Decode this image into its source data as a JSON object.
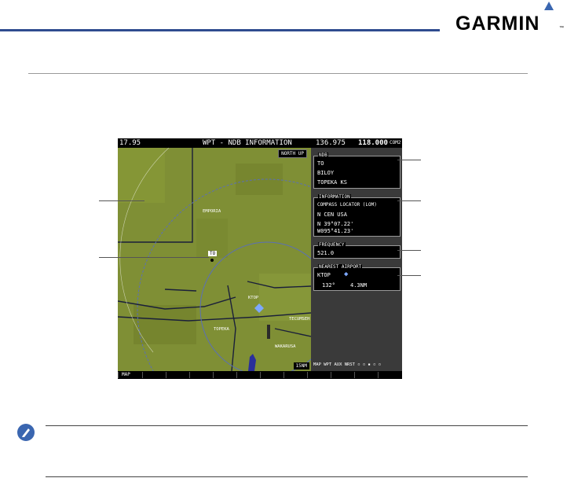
{
  "brand": {
    "name": "GARMIN",
    "tm": "™"
  },
  "screen": {
    "topbar": {
      "nav_freq": "17.95",
      "page_title": "WPT - NDB INFORMATION",
      "com_standby": "136.975",
      "com_active": "118.000",
      "com_label": "COM2"
    },
    "map": {
      "orientation": "NORTH UP",
      "range": "15NM",
      "waypoint_label": "TO",
      "place_labels": [
        "EMPORIA",
        "KTOP",
        "TOPEKA",
        "TECUMSEH",
        "WAKARUSA"
      ]
    },
    "ndb": {
      "title": "NDB",
      "ident": "TO",
      "name": "BILOY",
      "city": "TOPEKA KS"
    },
    "information": {
      "title": "INFORMATION",
      "type": "COMPASS LOCATOR (LOM)",
      "region": "N CEN USA",
      "lat": "N 39°07.22'",
      "lon": "W095°41.23'"
    },
    "frequency": {
      "title": "FREQUENCY",
      "value": "521.0"
    },
    "nearest_airport": {
      "title": "NEAREST AIRPORT",
      "ident": "KTOP",
      "bearing": "132°",
      "distance": "4.3NM"
    },
    "page_group": "MAP WPT AUX NRST",
    "softkeys": [
      "MAP",
      "",
      "",
      "",
      "",
      "",
      "",
      "",
      "",
      "",
      "",
      ""
    ]
  },
  "colors": {
    "accent_line": "#2f4c8f",
    "logo_triangle": "#3a66b0",
    "map_terrain": "#7f8f35",
    "airport_symbol": "#7da8ff"
  }
}
